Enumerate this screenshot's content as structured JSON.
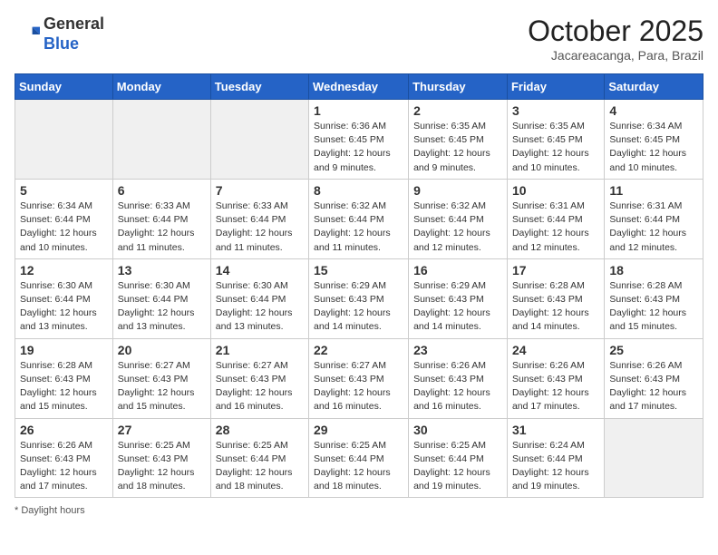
{
  "header": {
    "logo_line1": "General",
    "logo_line2": "Blue",
    "month": "October 2025",
    "location": "Jacareacanga, Para, Brazil"
  },
  "days_of_week": [
    "Sunday",
    "Monday",
    "Tuesday",
    "Wednesday",
    "Thursday",
    "Friday",
    "Saturday"
  ],
  "weeks": [
    [
      {
        "day": "",
        "content": ""
      },
      {
        "day": "",
        "content": ""
      },
      {
        "day": "",
        "content": ""
      },
      {
        "day": "1",
        "content": "Sunrise: 6:36 AM\nSunset: 6:45 PM\nDaylight: 12 hours and 9 minutes."
      },
      {
        "day": "2",
        "content": "Sunrise: 6:35 AM\nSunset: 6:45 PM\nDaylight: 12 hours and 9 minutes."
      },
      {
        "day": "3",
        "content": "Sunrise: 6:35 AM\nSunset: 6:45 PM\nDaylight: 12 hours and 10 minutes."
      },
      {
        "day": "4",
        "content": "Sunrise: 6:34 AM\nSunset: 6:45 PM\nDaylight: 12 hours and 10 minutes."
      }
    ],
    [
      {
        "day": "5",
        "content": "Sunrise: 6:34 AM\nSunset: 6:44 PM\nDaylight: 12 hours and 10 minutes."
      },
      {
        "day": "6",
        "content": "Sunrise: 6:33 AM\nSunset: 6:44 PM\nDaylight: 12 hours and 11 minutes."
      },
      {
        "day": "7",
        "content": "Sunrise: 6:33 AM\nSunset: 6:44 PM\nDaylight: 12 hours and 11 minutes."
      },
      {
        "day": "8",
        "content": "Sunrise: 6:32 AM\nSunset: 6:44 PM\nDaylight: 12 hours and 11 minutes."
      },
      {
        "day": "9",
        "content": "Sunrise: 6:32 AM\nSunset: 6:44 PM\nDaylight: 12 hours and 12 minutes."
      },
      {
        "day": "10",
        "content": "Sunrise: 6:31 AM\nSunset: 6:44 PM\nDaylight: 12 hours and 12 minutes."
      },
      {
        "day": "11",
        "content": "Sunrise: 6:31 AM\nSunset: 6:44 PM\nDaylight: 12 hours and 12 minutes."
      }
    ],
    [
      {
        "day": "12",
        "content": "Sunrise: 6:30 AM\nSunset: 6:44 PM\nDaylight: 12 hours and 13 minutes."
      },
      {
        "day": "13",
        "content": "Sunrise: 6:30 AM\nSunset: 6:44 PM\nDaylight: 12 hours and 13 minutes."
      },
      {
        "day": "14",
        "content": "Sunrise: 6:30 AM\nSunset: 6:44 PM\nDaylight: 12 hours and 13 minutes."
      },
      {
        "day": "15",
        "content": "Sunrise: 6:29 AM\nSunset: 6:43 PM\nDaylight: 12 hours and 14 minutes."
      },
      {
        "day": "16",
        "content": "Sunrise: 6:29 AM\nSunset: 6:43 PM\nDaylight: 12 hours and 14 minutes."
      },
      {
        "day": "17",
        "content": "Sunrise: 6:28 AM\nSunset: 6:43 PM\nDaylight: 12 hours and 14 minutes."
      },
      {
        "day": "18",
        "content": "Sunrise: 6:28 AM\nSunset: 6:43 PM\nDaylight: 12 hours and 15 minutes."
      }
    ],
    [
      {
        "day": "19",
        "content": "Sunrise: 6:28 AM\nSunset: 6:43 PM\nDaylight: 12 hours and 15 minutes."
      },
      {
        "day": "20",
        "content": "Sunrise: 6:27 AM\nSunset: 6:43 PM\nDaylight: 12 hours and 15 minutes."
      },
      {
        "day": "21",
        "content": "Sunrise: 6:27 AM\nSunset: 6:43 PM\nDaylight: 12 hours and 16 minutes."
      },
      {
        "day": "22",
        "content": "Sunrise: 6:27 AM\nSunset: 6:43 PM\nDaylight: 12 hours and 16 minutes."
      },
      {
        "day": "23",
        "content": "Sunrise: 6:26 AM\nSunset: 6:43 PM\nDaylight: 12 hours and 16 minutes."
      },
      {
        "day": "24",
        "content": "Sunrise: 6:26 AM\nSunset: 6:43 PM\nDaylight: 12 hours and 17 minutes."
      },
      {
        "day": "25",
        "content": "Sunrise: 6:26 AM\nSunset: 6:43 PM\nDaylight: 12 hours and 17 minutes."
      }
    ],
    [
      {
        "day": "26",
        "content": "Sunrise: 6:26 AM\nSunset: 6:43 PM\nDaylight: 12 hours and 17 minutes."
      },
      {
        "day": "27",
        "content": "Sunrise: 6:25 AM\nSunset: 6:43 PM\nDaylight: 12 hours and 18 minutes."
      },
      {
        "day": "28",
        "content": "Sunrise: 6:25 AM\nSunset: 6:44 PM\nDaylight: 12 hours and 18 minutes."
      },
      {
        "day": "29",
        "content": "Sunrise: 6:25 AM\nSunset: 6:44 PM\nDaylight: 12 hours and 18 minutes."
      },
      {
        "day": "30",
        "content": "Sunrise: 6:25 AM\nSunset: 6:44 PM\nDaylight: 12 hours and 19 minutes."
      },
      {
        "day": "31",
        "content": "Sunrise: 6:24 AM\nSunset: 6:44 PM\nDaylight: 12 hours and 19 minutes."
      },
      {
        "day": "",
        "content": ""
      }
    ]
  ],
  "footer": {
    "note": "Daylight hours"
  }
}
